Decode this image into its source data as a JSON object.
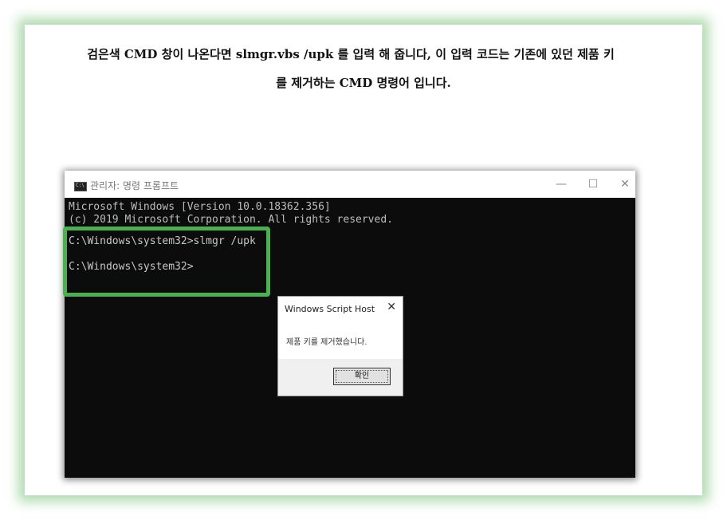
{
  "caption": {
    "line1": "검은색 CMD 창이 나온다면 slmgr.vbs /upk 를 입력 해 줍니다, 이 입력 코드는 기존에 있던 제품 키",
    "line2": "를 제거하는 CMD 명령어 입니다."
  },
  "cmd_window": {
    "title": "관리자: 명령 프롬프트",
    "icon_label": "C:\\",
    "controls": {
      "minimize": "—",
      "maximize": "☐",
      "close": "✕"
    },
    "output": [
      "Microsoft Windows [Version 10.0.18362.356]",
      "(c) 2019 Microsoft Corporation. All rights reserved."
    ],
    "prompt1": "C:\\Windows\\system32>slmgr /upk",
    "prompt2": "C:\\Windows\\system32>"
  },
  "dialog": {
    "title": "Windows Script Host",
    "close": "✕",
    "message": "제품 키를 제거했습니다.",
    "ok_label": "확인"
  },
  "colors": {
    "highlight": "#4caf50",
    "frame_glow": "#6ebe6e",
    "console_bg": "#0c0c0c"
  }
}
